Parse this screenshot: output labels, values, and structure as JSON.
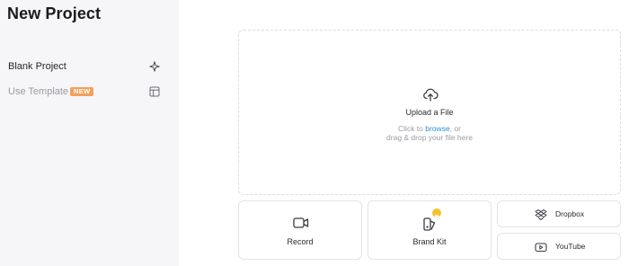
{
  "sidebar": {
    "title": "New Project",
    "items": [
      {
        "label": "Blank Project",
        "icon": "sparkle-icon"
      },
      {
        "label": "Use Template",
        "badge": "NEW",
        "icon": "layout-template-icon"
      }
    ]
  },
  "upload": {
    "title": "Upload a File",
    "line1_prefix": "Click to ",
    "browse": "browse",
    "line1_suffix": ", or",
    "line2": "drag & drop your file here",
    "icon": "upload-cloud-icon"
  },
  "actions": {
    "record": {
      "label": "Record",
      "icon": "video-camera-icon"
    },
    "brand_kit": {
      "label": "Brand Kit",
      "icon": "brand-kit-icon"
    },
    "dropbox": {
      "label": "Dropbox",
      "icon": "dropbox-icon"
    },
    "youtube": {
      "label": "YouTube",
      "icon": "youtube-icon"
    }
  },
  "colors": {
    "sidebar_bg": "#f6f6f8",
    "badge": "#f2a25a",
    "link": "#2b8fd8",
    "brand_dot": "#f5c12e"
  }
}
